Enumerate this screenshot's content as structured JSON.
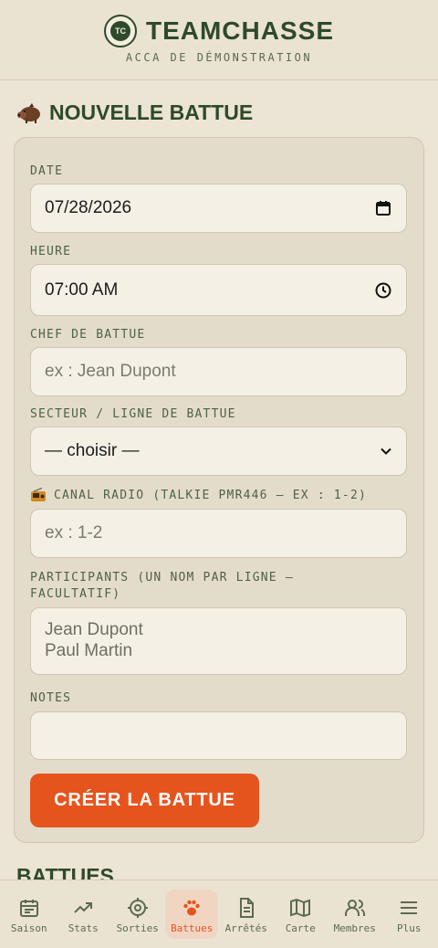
{
  "header": {
    "title": "TEAMCHASSE",
    "subtitle": "ACCA DE DÉMONSTRATION",
    "logo_text": "TC"
  },
  "form": {
    "title": "NOUVELLE BATTUE",
    "date": {
      "label": "DATE",
      "value": "07/28/2026"
    },
    "time": {
      "label": "HEURE",
      "value": "07:00 AM"
    },
    "chef": {
      "label": "CHEF DE BATTUE",
      "placeholder": "ex : Jean Dupont"
    },
    "secteur": {
      "label": "SECTEUR / LIGNE DE BATTUE",
      "selected": "— choisir —"
    },
    "radio": {
      "label": "CANAL RADIO (TALKIE PMR446 — EX : 1-2)",
      "placeholder": "ex : 1-2"
    },
    "participants": {
      "label_line1": "PARTICIPANTS (UN NOM PAR LIGNE —",
      "label_line2": "FACULTATIF)",
      "placeholder_line1": "Jean Dupont",
      "placeholder_line2": "Paul Martin"
    },
    "notes": {
      "label": "NOTES",
      "value": ""
    },
    "submit": "CRÉER LA BATTUE"
  },
  "list_title": "BATTUES",
  "nav": [
    {
      "label": "Saison",
      "icon": "calendar-icon",
      "active": false
    },
    {
      "label": "Stats",
      "icon": "trend-icon",
      "active": false
    },
    {
      "label": "Sorties",
      "icon": "crosshair-icon",
      "active": false
    },
    {
      "label": "Battues",
      "icon": "paw-icon",
      "active": true
    },
    {
      "label": "Arrêtés",
      "icon": "document-icon",
      "active": false
    },
    {
      "label": "Carte",
      "icon": "map-icon",
      "active": false
    },
    {
      "label": "Membres",
      "icon": "users-icon",
      "active": false
    },
    {
      "label": "Plus",
      "icon": "menu-icon",
      "active": false
    }
  ],
  "colors": {
    "accent": "#e6541e",
    "primary": "#2e4a2a",
    "background": "#ece4d4"
  }
}
